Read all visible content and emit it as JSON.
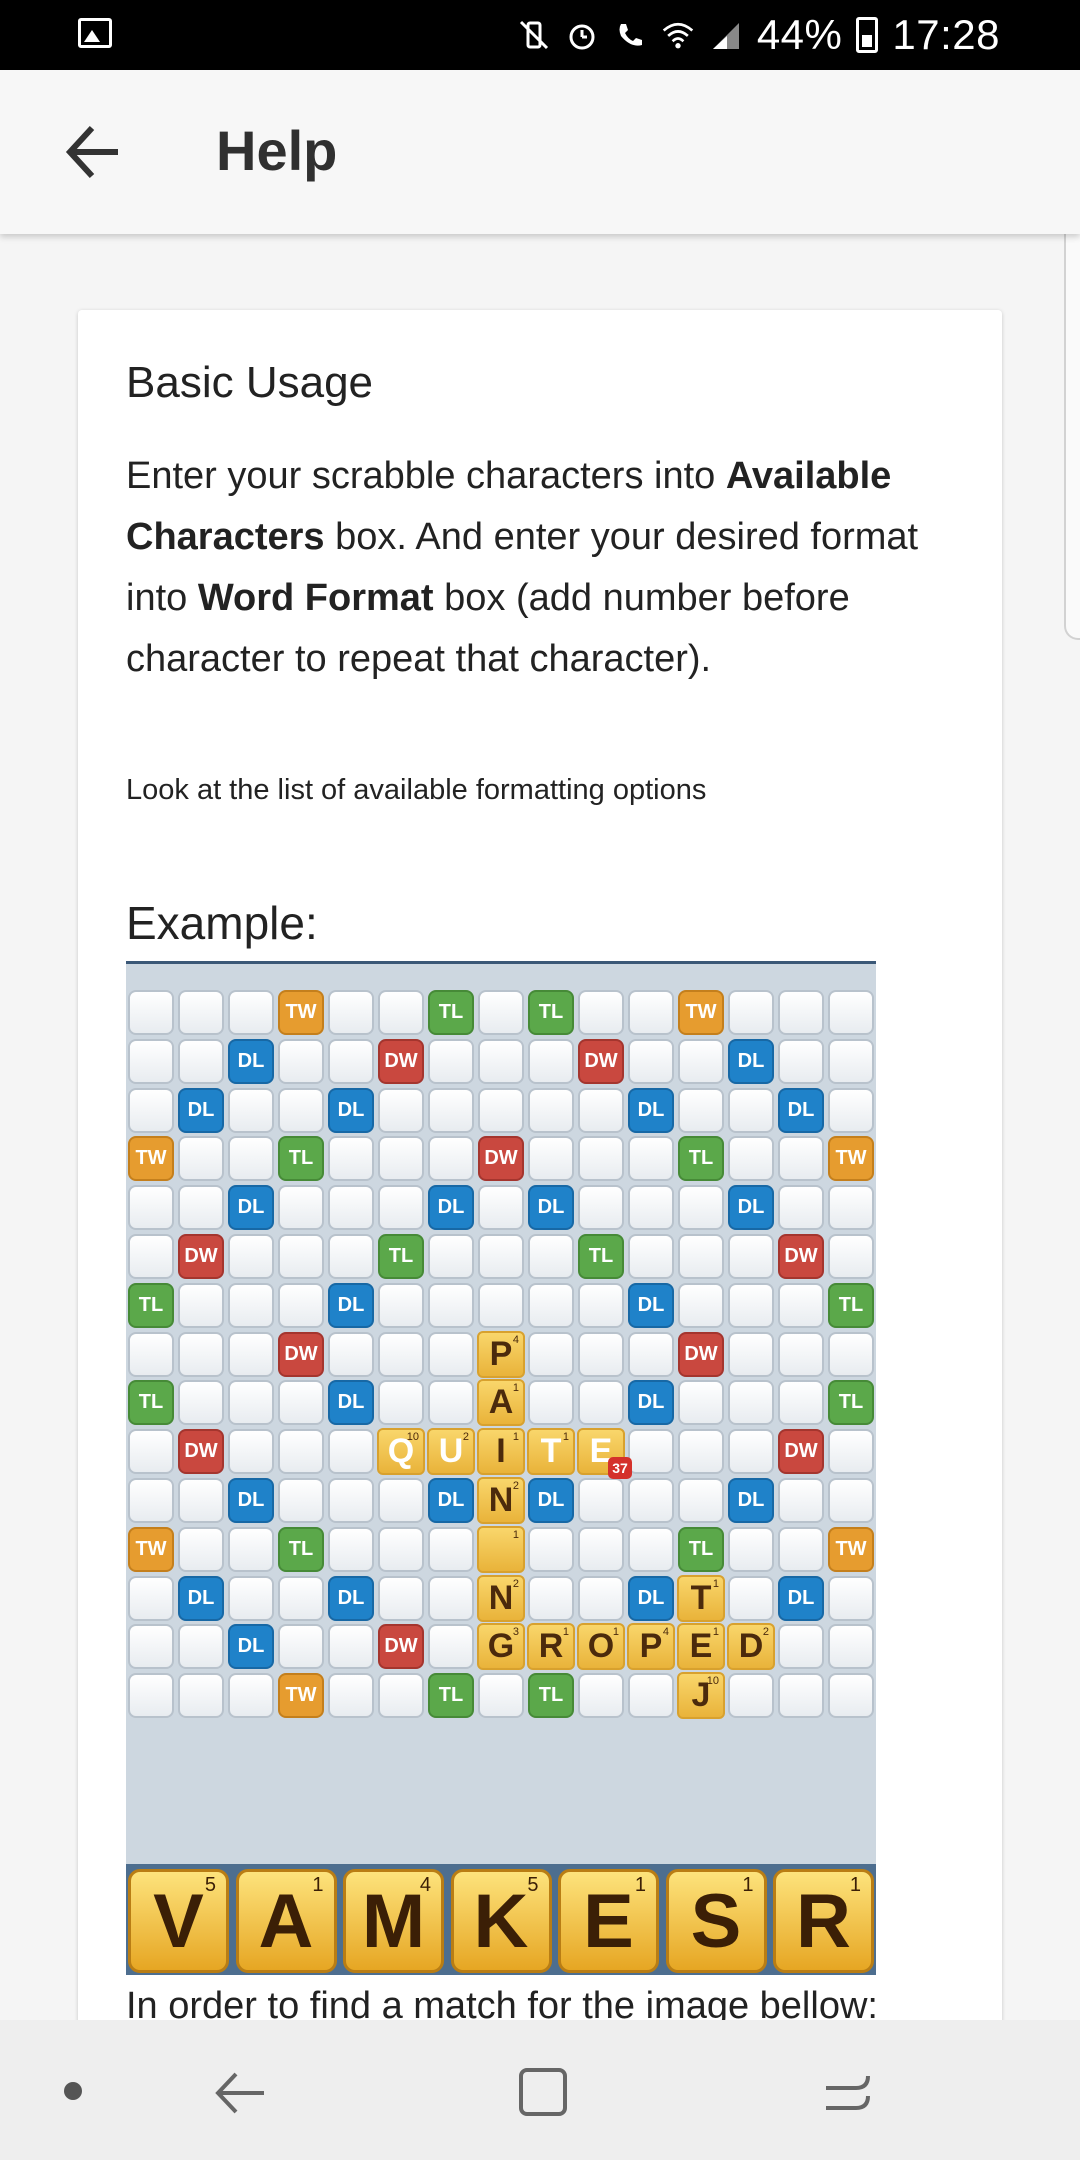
{
  "status_bar": {
    "battery": "44%",
    "time": "17:28",
    "icons": [
      "gallery-icon",
      "vibrate-mute-icon",
      "alarm-icon",
      "wifi-call-icon",
      "wifi-icon",
      "signal-icon",
      "battery-icon"
    ]
  },
  "app_bar": {
    "title": "Help",
    "back_icon": "back-arrow-icon"
  },
  "card": {
    "title": "Basic Usage",
    "para_part1": "Enter your scrabble characters into ",
    "bold1": "Available Characters",
    "para_part2": " box. And enter your desired format into ",
    "bold2": "Word Format",
    "para_part3": " box (add number before character to repeat that character).",
    "note": "Look at the list of available formatting options",
    "example_label": "Example:",
    "after_text": "In order to find a match for the image bellow:"
  },
  "board": {
    "rows": [
      [
        "",
        "",
        "",
        "TW",
        "",
        "",
        "TL",
        "",
        "TL",
        "",
        "",
        "TW",
        "",
        "",
        ""
      ],
      [
        "",
        "",
        "DL",
        "",
        "",
        "DW",
        "",
        "",
        "",
        "DW",
        "",
        "",
        "DL",
        "",
        ""
      ],
      [
        "",
        "DL",
        "",
        "",
        "DL",
        "",
        "",
        "",
        "",
        "",
        "DL",
        "",
        "",
        "DL",
        ""
      ],
      [
        "TW",
        "",
        "",
        "TL",
        "",
        "",
        "",
        "DW",
        "",
        "",
        "",
        "TL",
        "",
        "",
        "TW"
      ],
      [
        "",
        "",
        "DL",
        "",
        "",
        "",
        "DL",
        "",
        "DL",
        "",
        "",
        "",
        "DL",
        "",
        ""
      ],
      [
        "",
        "DW",
        "",
        "",
        "",
        "TL",
        "",
        "",
        "",
        "TL",
        "",
        "",
        "",
        "DW",
        ""
      ],
      [
        "TL",
        "",
        "",
        "",
        "DL",
        "",
        "",
        "",
        "",
        "",
        "DL",
        "",
        "",
        "",
        "TL"
      ],
      [
        "",
        "",
        "",
        "DW",
        "",
        "",
        "",
        "",
        "",
        "",
        "",
        "DW",
        "",
        "",
        ""
      ],
      [
        "TL",
        "",
        "",
        "",
        "DL",
        "",
        "",
        "",
        "",
        "",
        "DL",
        "",
        "",
        "",
        "TL"
      ],
      [
        "",
        "DW",
        "",
        "",
        "",
        "",
        "",
        "",
        "",
        "",
        "",
        "",
        "",
        "DW",
        ""
      ],
      [
        "",
        "",
        "DL",
        "",
        "",
        "",
        "DL",
        "",
        "DL",
        "",
        "",
        "",
        "DL",
        "",
        ""
      ],
      [
        "TW",
        "",
        "",
        "TL",
        "",
        "",
        "",
        "",
        "",
        "",
        "",
        "TL",
        "",
        "",
        "TW"
      ],
      [
        "",
        "DL",
        "",
        "",
        "DL",
        "",
        "",
        "",
        "",
        "",
        "DL",
        "",
        "",
        "DL",
        ""
      ],
      [
        "",
        "",
        "DL",
        "",
        "",
        "DW",
        "",
        "",
        "",
        "",
        "",
        "",
        "",
        "",
        ""
      ],
      [
        "",
        "",
        "",
        "TW",
        "",
        "",
        "TL",
        "",
        "TL",
        "",
        "",
        "",
        "",
        "",
        ""
      ]
    ],
    "tiles": [
      {
        "r": 7,
        "c": 7,
        "l": "P",
        "p": "4"
      },
      {
        "r": 8,
        "c": 7,
        "l": "A",
        "p": "1"
      },
      {
        "r": 9,
        "c": 5,
        "l": "Q",
        "p": "10",
        "light": true
      },
      {
        "r": 9,
        "c": 6,
        "l": "U",
        "p": "2",
        "light": true
      },
      {
        "r": 9,
        "c": 7,
        "l": "I",
        "p": "1"
      },
      {
        "r": 9,
        "c": 8,
        "l": "T",
        "p": "1",
        "light": true
      },
      {
        "r": 9,
        "c": 9,
        "l": "E",
        "p": "",
        "light": true
      },
      {
        "r": 10,
        "c": 7,
        "l": "N",
        "p": "2"
      },
      {
        "r": 11,
        "c": 7,
        "l": "",
        "p": "1"
      },
      {
        "r": 12,
        "c": 7,
        "l": "N",
        "p": "2"
      },
      {
        "r": 13,
        "c": 7,
        "l": "G",
        "p": "3"
      },
      {
        "r": 13,
        "c": 8,
        "l": "R",
        "p": "1"
      },
      {
        "r": 13,
        "c": 9,
        "l": "O",
        "p": "1"
      },
      {
        "r": 13,
        "c": 10,
        "l": "P",
        "p": "4"
      },
      {
        "r": 13,
        "c": 11,
        "l": "E",
        "p": "1"
      },
      {
        "r": 13,
        "c": 12,
        "l": "D",
        "p": "2"
      },
      {
        "r": 12,
        "c": 11,
        "l": "T",
        "p": "1"
      },
      {
        "r": 14,
        "c": 11,
        "l": "J",
        "p": "10"
      }
    ],
    "badge": "37"
  },
  "rack": [
    {
      "l": "V",
      "p": "5"
    },
    {
      "l": "A",
      "p": "1"
    },
    {
      "l": "M",
      "p": "4"
    },
    {
      "l": "K",
      "p": "5"
    },
    {
      "l": "E",
      "p": "1"
    },
    {
      "l": "S",
      "p": "1"
    },
    {
      "l": "R",
      "p": "1"
    }
  ],
  "nav_bar": {
    "icons": [
      "dot-indicator-icon",
      "back-nav-icon",
      "home-nav-icon",
      "recents-nav-icon"
    ]
  }
}
